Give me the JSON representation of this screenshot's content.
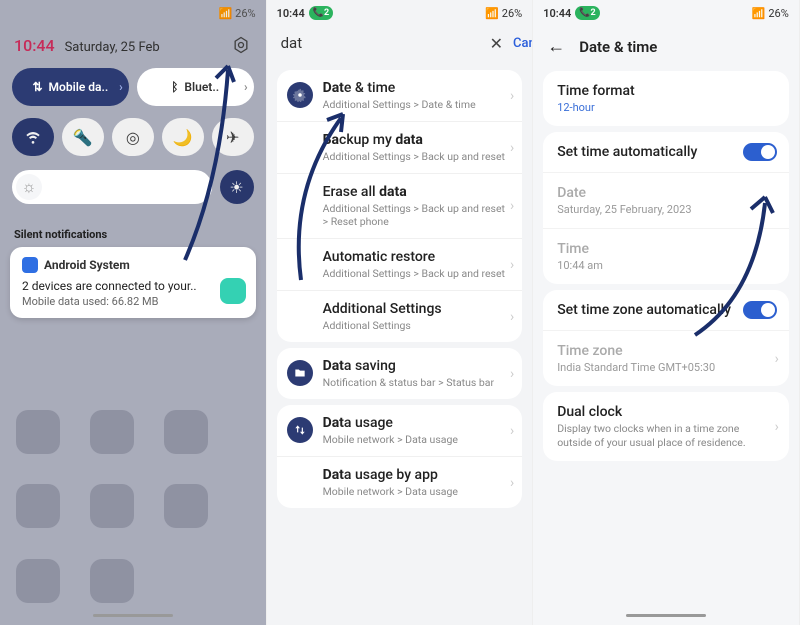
{
  "status": {
    "time": "10:44",
    "badge": "2",
    "battery": "26%"
  },
  "p1": {
    "time": "10:44",
    "date": "Saturday, 25 Feb",
    "mobile_data": "Mobile da..",
    "bluetooth": "Bluet..",
    "silent_label": "Silent notifications",
    "notif": {
      "app": "Android System",
      "line1": "2 devices are connected to your..",
      "line2": "Mobile data used: 66.82 MB"
    }
  },
  "p2": {
    "query": "dat",
    "cancel": "Cancel",
    "g1": [
      {
        "title_pre": "Dat",
        "title_mid": "e",
        "title_post": " & time",
        "sub": "Additional Settings > Date & time",
        "icon": true
      },
      {
        "title_pre": "Ba",
        "title_mid": "ckup my ",
        "hl": "data",
        "sub": "Additional Settings > Back up and reset"
      },
      {
        "title_pre": "Erase all ",
        "hl": "data",
        "sub": "Additional Settings > Back up and reset > Reset phone"
      },
      {
        "title_pre": "Automatic restore",
        "sub": "Additional Settings > Back up and reset"
      },
      {
        "title_pre": "Additional Settings",
        "sub": "Additional Settings"
      }
    ],
    "g2": [
      {
        "hl": "Dat",
        "title_post": "a saving",
        "sub": "Notification & status bar > Status bar",
        "icon": true
      }
    ],
    "g3": [
      {
        "hl": "Dat",
        "title_post": "a usage",
        "sub": "Mobile network > Data usage",
        "icon": true
      },
      {
        "hl": "Dat",
        "title_post": "a usage by app",
        "sub": "Mobile network > Data usage"
      }
    ]
  },
  "p3": {
    "title": "Date & time",
    "time_format": {
      "label": "Time format",
      "value": "12-hour"
    },
    "auto_time": "Set time automatically",
    "date": {
      "label": "Date",
      "value": "Saturday, 25 February, 2023"
    },
    "time": {
      "label": "Time",
      "value": "10:44 am"
    },
    "auto_tz": "Set time zone automatically",
    "tz": {
      "label": "Time zone",
      "value": "India Standard Time GMT+05:30"
    },
    "dual": {
      "label": "Dual clock",
      "desc": "Display two clocks when in a time zone outside of your usual place of residence."
    }
  }
}
